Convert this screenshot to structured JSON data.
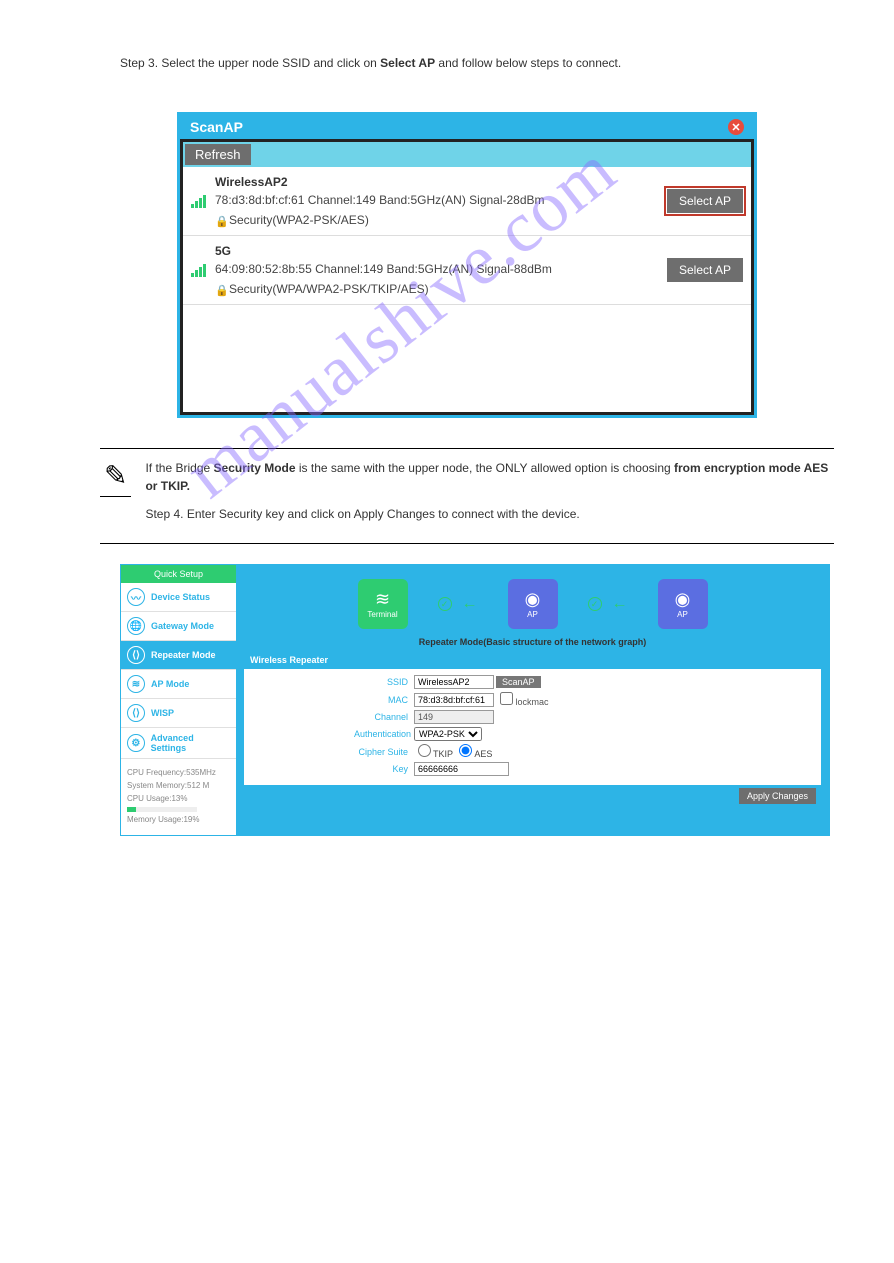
{
  "watermark": {
    "text": "manualshive.com"
  },
  "scanap": {
    "title": "ScanAP",
    "refresh": "Refresh",
    "items": [
      {
        "ssid": "WirelessAP2",
        "detail": "78:d3:8d:bf:cf:61 Channel:149 Band:5GHz(AN) Signal-28dBm",
        "security": "Security(WPA2-PSK/AES)",
        "select": "Select AP",
        "highlighted": true
      },
      {
        "ssid": "5G",
        "detail": "64:09:80:52:8b:55 Channel:149 Band:5GHz(AN) Signal-88dBm",
        "security": "Security(WPA/WPA2-PSK/TKIP/AES)",
        "select": "Select AP",
        "highlighted": false
      }
    ]
  },
  "note": {
    "line1_prefix": "If the Bridge ",
    "line1_bold": "Security Mode",
    "line1_suffix": " is the same with the upper node, the ONLY allowed option is choosing ",
    "line1_bold2": "from encryption mode AES or TKIP.",
    "line2": "Step 4. Enter Security key and click on Apply Changes to connect with the device."
  },
  "step3": {
    "text_prefix": "Step 3. Select the upper node SSID and click on ",
    "text_bold": "Select AP",
    "text_suffix": " and follow below steps to connect."
  },
  "router": {
    "sidebar": {
      "header": "Quick Setup",
      "items": [
        {
          "name": "device-status",
          "label": "Device Status"
        },
        {
          "name": "gateway-mode",
          "label": "Gateway Mode"
        },
        {
          "name": "repeater-mode",
          "label": "Repeater Mode",
          "active": true
        },
        {
          "name": "ap-mode",
          "label": "AP Mode"
        },
        {
          "name": "wisp",
          "label": "WISP"
        },
        {
          "name": "advanced-settings",
          "label": "Advanced Settings"
        }
      ],
      "stats": {
        "cpu_freq": "CPU Frequency:535MHz",
        "sys_mem": "System Memory:512 M",
        "cpu_usage": "CPU Usage:13%",
        "mem_usage": "Memory Usage:19%"
      }
    },
    "topology": {
      "terminal": "Terminal",
      "ap1": "AP",
      "ap2": "AP",
      "caption": "Repeater Mode(Basic structure of the network graph)"
    },
    "panel": {
      "title": "Wireless Repeater",
      "ssid_label": "SSID",
      "ssid_value": "WirelessAP2",
      "scanap_btn": "ScanAP",
      "mac_label": "MAC",
      "mac_value": "78:d3:8d:bf:cf:61",
      "lockmac_label": "lockmac",
      "channel_label": "Channel",
      "channel_value": "149",
      "auth_label": "Authentication",
      "auth_value": "WPA2-PSK",
      "cipher_label": "Cipher Suite",
      "cipher_tkip": "TKIP",
      "cipher_aes": "AES",
      "key_label": "Key",
      "key_value": "66666666",
      "apply": "Apply Changes"
    }
  }
}
